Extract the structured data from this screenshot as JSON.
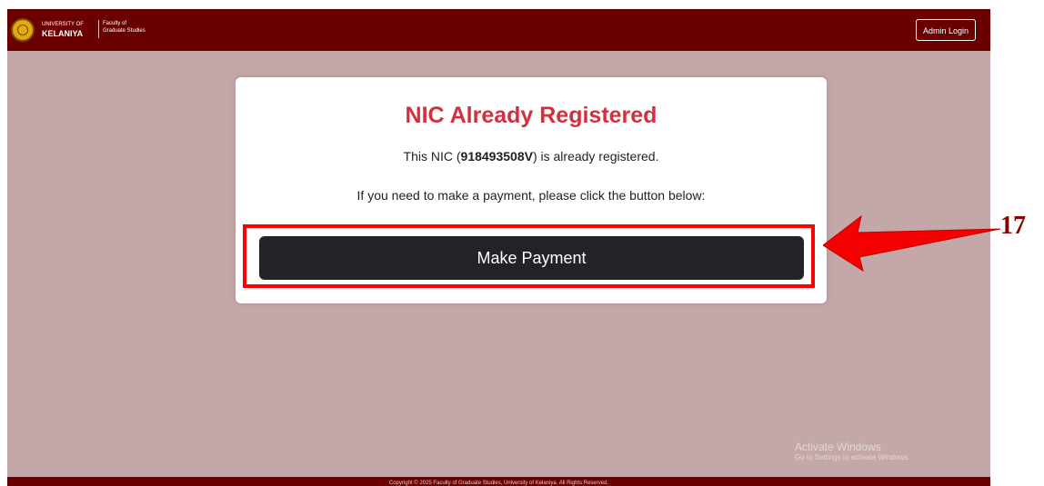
{
  "header": {
    "brand_line1": "UNIVERSITY OF",
    "brand_line2": "KELANIYA",
    "faculty_line1": "Faculty of",
    "faculty_line2": "Graduate Studies",
    "admin_login_label": "Admin Login"
  },
  "card": {
    "title": "NIC Already Registered",
    "nic_prefix": "This NIC (",
    "nic_value": "918493508V",
    "nic_suffix": ") is already registered.",
    "instruction": "If you need to make a payment, please click the button below:",
    "button_label": "Make Payment"
  },
  "footer": {
    "copyright": "Copyright © 2025 Faculty of Graduate Studies, University of Kelaniya. All Rights Reserved."
  },
  "watermark": {
    "title": "Activate Windows",
    "subtitle": "Go to Settings to activate Windows."
  },
  "annotation": {
    "step_number": "17"
  },
  "colors": {
    "header_bg": "#6b0000",
    "page_bg": "#c4a7a8",
    "title_red": "#d32f3f",
    "button_dark": "#212326",
    "highlight_red": "#ff0000"
  }
}
